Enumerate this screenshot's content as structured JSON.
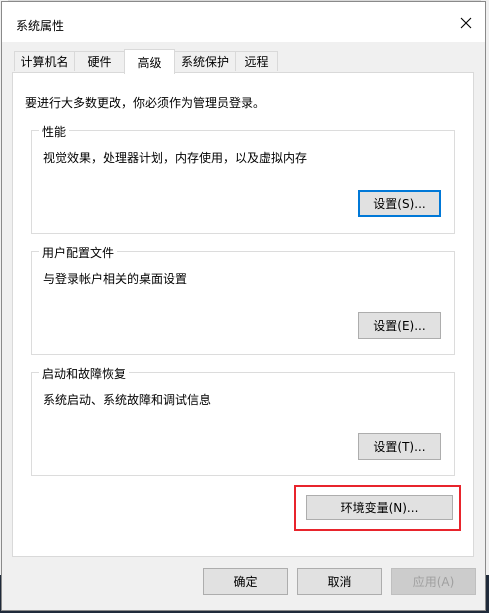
{
  "window": {
    "title": "系统属性"
  },
  "tabs": [
    {
      "label": "计算机名"
    },
    {
      "label": "硬件"
    },
    {
      "label": "高级"
    },
    {
      "label": "系统保护"
    },
    {
      "label": "远程"
    }
  ],
  "active_tab": "高级",
  "admin_note": "要进行大多数更改，你必须作为管理员登录。",
  "groups": {
    "performance": {
      "title": "性能",
      "description": "视觉效果，处理器计划，内存使用，以及虚拟内存",
      "button": "设置(S)..."
    },
    "user_profiles": {
      "title": "用户配置文件",
      "description": "与登录帐户相关的桌面设置",
      "button": "设置(E)..."
    },
    "startup_recovery": {
      "title": "启动和故障恢复",
      "description": "系统启动、系统故障和调试信息",
      "button": "设置(T)..."
    }
  },
  "env_vars_button": "环境变量(N)...",
  "footer": {
    "ok": "确定",
    "cancel": "取消",
    "apply": "应用(A)"
  },
  "colors": {
    "highlight": "#e8242c",
    "focus_border": "#0078d7"
  }
}
